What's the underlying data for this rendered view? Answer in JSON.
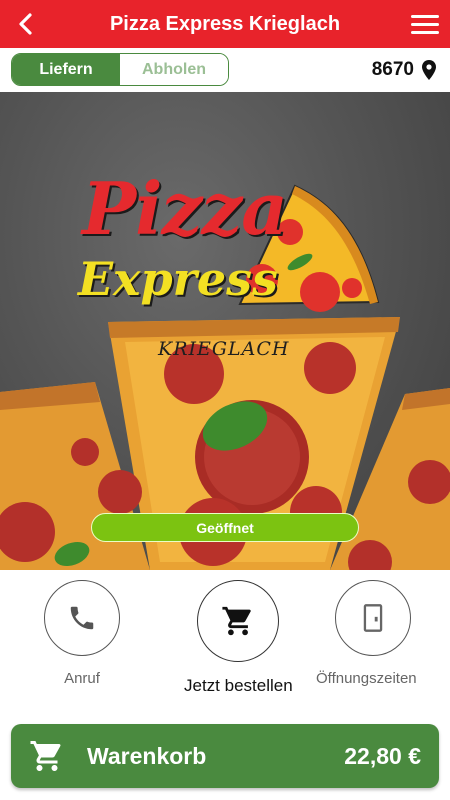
{
  "header": {
    "title": "Pizza Express Krieglach",
    "back_icon": "chevron-left-icon",
    "menu_icon": "hamburger-menu-icon"
  },
  "mode": {
    "delivery_label": "Liefern",
    "pickup_label": "Abholen",
    "selected": "Liefern",
    "postcode": "8670",
    "location_icon": "map-pin-icon"
  },
  "hero": {
    "logo": {
      "line1": "Pizza",
      "line2": "Express",
      "line3": "KRIEGLACH"
    },
    "status_badge": "Geöffnet"
  },
  "actions": [
    {
      "label": "Anruf",
      "icon": "phone-icon"
    },
    {
      "label": "Jetzt bestellen",
      "icon": "shopping-cart-icon"
    },
    {
      "label": "Öffnungszeiten",
      "icon": "door-icon"
    }
  ],
  "cart": {
    "label": "Warenkorb",
    "total": "22,80 €",
    "icon": "shopping-cart-icon"
  },
  "colors": {
    "header_red": "#e8232b",
    "brand_green": "#4a8a3f",
    "open_green": "#7cc311"
  }
}
